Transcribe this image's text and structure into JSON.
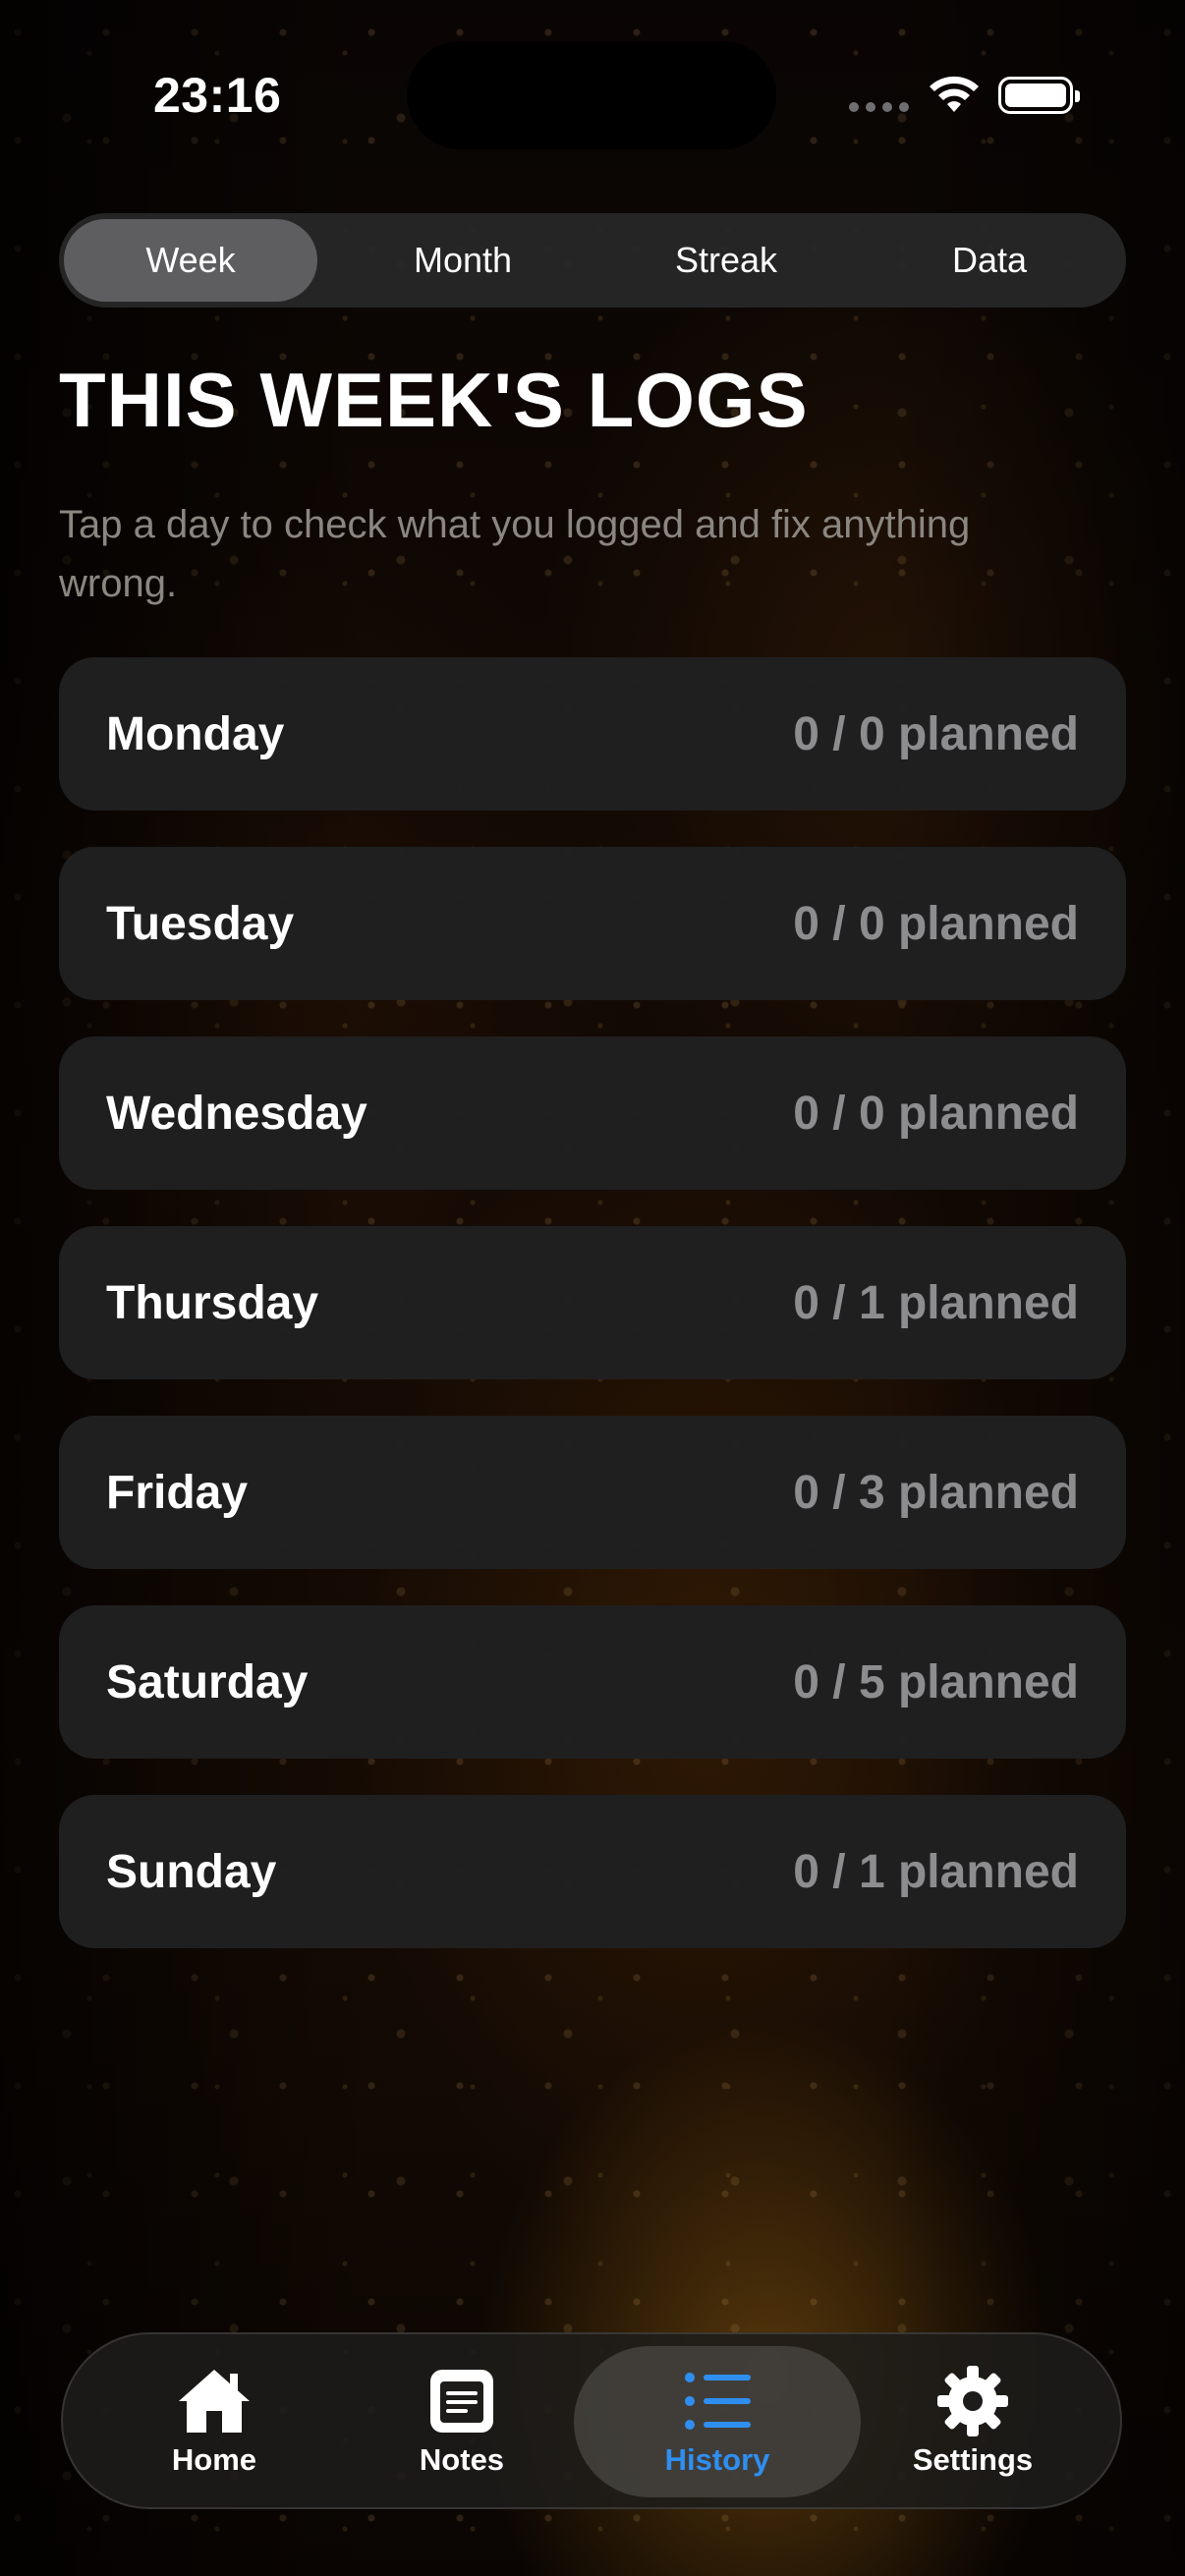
{
  "status_bar": {
    "time": "23:16"
  },
  "segments": [
    {
      "label": "Week",
      "active": true
    },
    {
      "label": "Month",
      "active": false
    },
    {
      "label": "Streak",
      "active": false
    },
    {
      "label": "Data",
      "active": false
    }
  ],
  "page": {
    "title": "THIS WEEK'S LOGS",
    "subtitle": "Tap a day to check what you logged and fix anything wrong."
  },
  "days": [
    {
      "name": "Monday",
      "count": "0 / 0 planned"
    },
    {
      "name": "Tuesday",
      "count": "0 / 0 planned"
    },
    {
      "name": "Wednesday",
      "count": "0 / 0 planned"
    },
    {
      "name": "Thursday",
      "count": "0 / 1 planned"
    },
    {
      "name": "Friday",
      "count": "0 / 3 planned"
    },
    {
      "name": "Saturday",
      "count": "0 / 5 planned"
    },
    {
      "name": "Sunday",
      "count": "0 / 1 planned"
    }
  ],
  "tabbar": {
    "items": [
      {
        "label": "Home",
        "icon": "house-icon",
        "active": false
      },
      {
        "label": "Notes",
        "icon": "note-icon",
        "active": false
      },
      {
        "label": "History",
        "icon": "list-icon",
        "active": true
      },
      {
        "label": "Settings",
        "icon": "gear-icon",
        "active": false
      }
    ]
  },
  "colors": {
    "accent": "#2f8ff0",
    "card": "#202021",
    "muted_text": "#8d8d8f"
  }
}
